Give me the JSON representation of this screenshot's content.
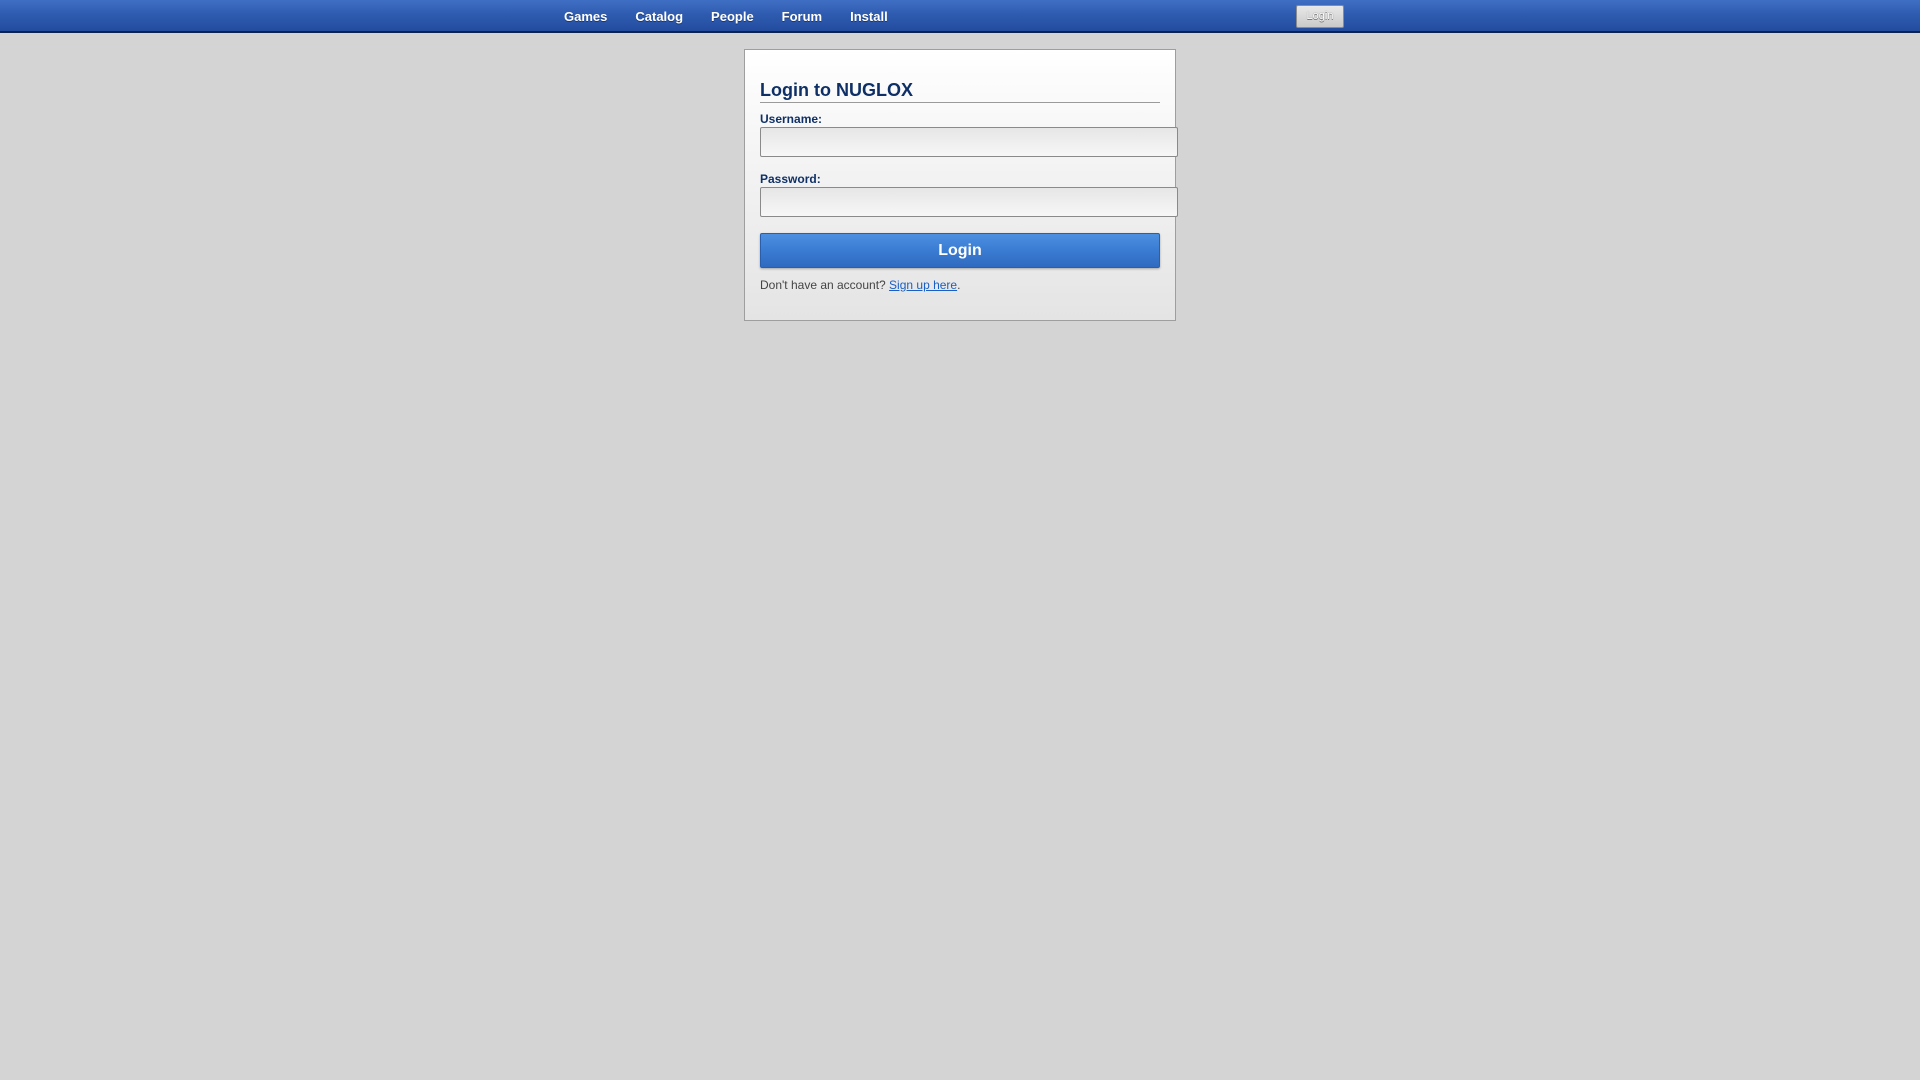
{
  "nav": {
    "items": [
      {
        "label": "Games"
      },
      {
        "label": "Catalog"
      },
      {
        "label": "People"
      },
      {
        "label": "Forum"
      },
      {
        "label": "Install"
      }
    ],
    "login_button": "Login"
  },
  "login_form": {
    "title": "Login to NUGLOX",
    "username_label": "Username:",
    "username_value": "",
    "password_label": "Password:",
    "password_value": "",
    "submit_label": "Login",
    "signup_prompt": "Don't have an account?",
    "signup_link": "Sign up here",
    "signup_suffix": "."
  },
  "colors": {
    "topbar": "#2f5cb0",
    "background": "#d4d4d4",
    "title_text": "#0f3066",
    "login_button": "#3a7cd2",
    "link": "#1a5fc4"
  }
}
